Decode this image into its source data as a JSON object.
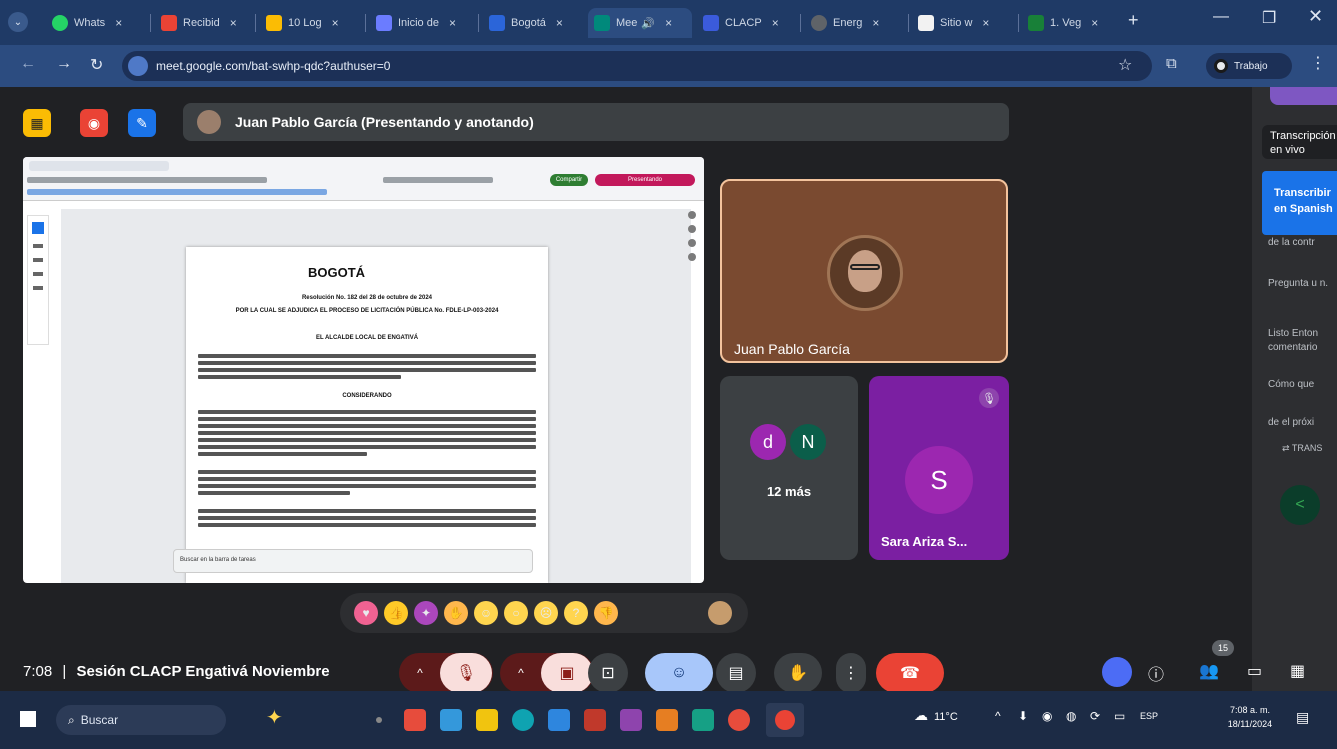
{
  "browser": {
    "tabs": [
      {
        "label": "Whats",
        "color": "#25d366"
      },
      {
        "label": "Recibid",
        "color": "#ea4335"
      },
      {
        "label": "10 Log",
        "color": "#1a73e8"
      },
      {
        "label": "Inicio de",
        "color": "#6b7cff"
      },
      {
        "label": "Bogotá",
        "color": "#2b65d9"
      },
      {
        "label": "Mee",
        "color": "#00897b"
      },
      {
        "label": "CLACP",
        "color": "#3b5bdb"
      },
      {
        "label": "Energ",
        "color": "#5f6368"
      },
      {
        "label": "Sitio w",
        "color": "#f2f2f2"
      },
      {
        "label": "1. Veg",
        "color": "#188038"
      }
    ],
    "new_tab": "+",
    "url": "meet.google.com/bat-swhp-qdc?authuser=0",
    "profile_label": "Trabajo"
  },
  "meet": {
    "presenter_banner": "Juan Pablo García (Presentando y anotando)",
    "tiles": {
      "main_name": "Juan Pablo García",
      "more_initial_1": "d",
      "more_initial_2": "N",
      "more_label": "12 más",
      "sara_initial": "S",
      "sara_name": "Sara Ariza S..."
    },
    "shared_doc": {
      "logo": "BOGOTÁ",
      "resolution": "Resolución No. 182 del 28 de octubre de 2024",
      "heading": "POR LA CUAL SE ADJUDICA EL PROCESO DE LICITACIÓN PÚBLICA No. FDLE-LP-003-2024",
      "mayor": "EL ALCALDE LOCAL DE ENGATIVÁ",
      "considerando": "CONSIDERANDO",
      "side_search": "Buscar en la barra de tareas",
      "button_share": "Compartir",
      "button_present": "Presentando"
    },
    "transcript_panel": {
      "title": "Transcripción en vivo",
      "lang_card": "Transcribir en Spanish",
      "lines": [
        "de la contr",
        "Pregunta u n.",
        "Listo Enton comentario",
        "Cómo que",
        "de el próxi"
      ],
      "footer": "TRANS"
    },
    "bottom": {
      "time": "7:08",
      "separator": "|",
      "meeting_name": "Sesión CLACP Engativá Noviembre",
      "participants_count": "15"
    }
  },
  "taskbar": {
    "search_placeholder": "Buscar",
    "weather": "11°C",
    "lang": "ESP",
    "time": "7:08 a. m.",
    "date": "18/11/2024"
  }
}
